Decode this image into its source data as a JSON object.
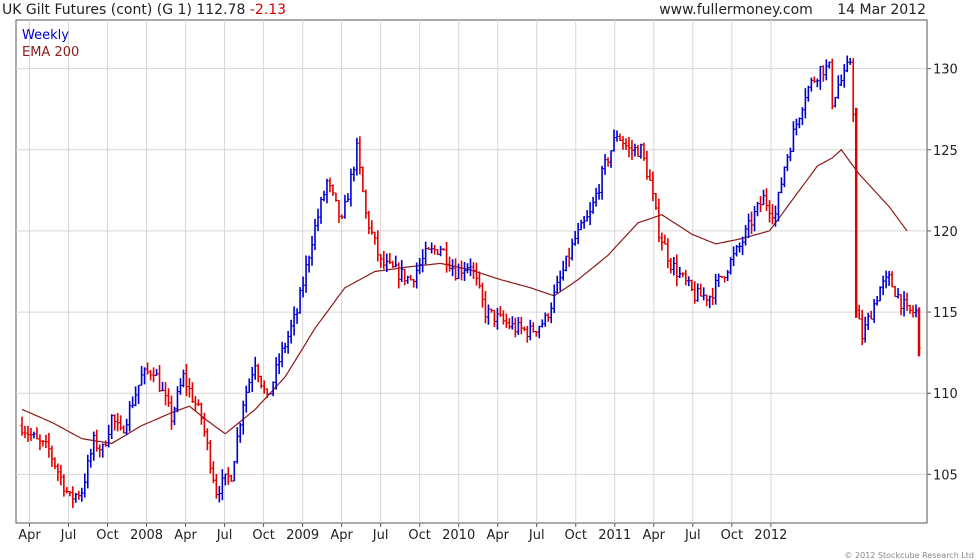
{
  "header": {
    "title": "UK Gilt Futures (cont) (G 1)",
    "last": "112.78",
    "change": "-2.13",
    "site": "www.fullermoney.com",
    "date": "14 Mar 2012"
  },
  "footer": "© 2012 Stockcube Research Ltd",
  "colors": {
    "up": "#0000cc",
    "down": "#e00000",
    "ema": "#8b1a1a",
    "grid": "#d7d7d7",
    "frame": "#555555"
  },
  "chart_data": {
    "type": "line",
    "title": "UK Gilt Futures (cont) (G 1)",
    "ylim": [
      102,
      133
    ],
    "yticks": [
      105,
      110,
      115,
      120,
      125,
      130
    ],
    "xticks": [
      "Apr",
      "Jul",
      "Oct",
      "2008",
      "Apr",
      "Jul",
      "Oct",
      "2009",
      "Apr",
      "Jul",
      "Oct",
      "2010",
      "Apr",
      "Jul",
      "Oct",
      "2011",
      "Apr",
      "Jul",
      "Oct",
      "2012"
    ],
    "legend": {
      "position": "top-left",
      "entries": [
        "Weekly",
        "EMA 200"
      ]
    },
    "grid": true,
    "x_start": "2007-03-30",
    "series": [
      {
        "name": "Weekly",
        "kind": "price",
        "anchors": [
          [
            0,
            108
          ],
          [
            5,
            107
          ],
          [
            9,
            106.5
          ],
          [
            16,
            103.5
          ],
          [
            20,
            104
          ],
          [
            24,
            107
          ],
          [
            27,
            106.5
          ],
          [
            30,
            108.5
          ],
          [
            33,
            107.5
          ],
          [
            40,
            111
          ],
          [
            44,
            111.5
          ],
          [
            50,
            108.5
          ],
          [
            54,
            111
          ],
          [
            60,
            108.5
          ],
          [
            65,
            104
          ],
          [
            70,
            105
          ],
          [
            74,
            109.5
          ],
          [
            78,
            112
          ],
          [
            82,
            109.5
          ],
          [
            86,
            112
          ],
          [
            92,
            115
          ],
          [
            97,
            119.5
          ],
          [
            102,
            123
          ],
          [
            107,
            120.5
          ],
          [
            112,
            125
          ],
          [
            115,
            121
          ],
          [
            120,
            118
          ],
          [
            125,
            117.5
          ],
          [
            130,
            117
          ],
          [
            135,
            118.5
          ],
          [
            140,
            119
          ],
          [
            145,
            117.5
          ],
          [
            150,
            118
          ],
          [
            155,
            115
          ],
          [
            160,
            114.5
          ],
          [
            165,
            114
          ],
          [
            170,
            113.8
          ],
          [
            175,
            114.5
          ],
          [
            180,
            117
          ],
          [
            185,
            119.5
          ],
          [
            190,
            121
          ],
          [
            195,
            124
          ],
          [
            199,
            126
          ],
          [
            203,
            125
          ],
          [
            207,
            125
          ],
          [
            210,
            123
          ],
          [
            213,
            120
          ],
          [
            217,
            118
          ],
          [
            221,
            117
          ],
          [
            225,
            116
          ],
          [
            230,
            116
          ],
          [
            235,
            117.5
          ],
          [
            240,
            119
          ],
          [
            245,
            121
          ],
          [
            248,
            122
          ],
          [
            252,
            121
          ],
          [
            255,
            124
          ],
          [
            258,
            126
          ],
          [
            262,
            128.5
          ],
          [
            267,
            130
          ],
          [
            270,
            130
          ],
          [
            271,
            128
          ],
          [
            273,
            129
          ],
          [
            275,
            129.5
          ],
          [
            277,
            130.5
          ],
          [
            278,
            127.5
          ],
          [
            279,
            115
          ],
          [
            281,
            113.5
          ],
          [
            284,
            115
          ],
          [
            287,
            116.5
          ],
          [
            290,
            117
          ],
          [
            293,
            116
          ],
          [
            296,
            115
          ],
          [
            299,
            115
          ],
          [
            300,
            112.78
          ]
        ]
      },
      {
        "name": "EMA 200",
        "kind": "line",
        "anchors": [
          [
            0,
            109
          ],
          [
            10,
            108.2
          ],
          [
            20,
            107.2
          ],
          [
            30,
            106.9
          ],
          [
            40,
            108
          ],
          [
            50,
            108.8
          ],
          [
            56,
            109.2
          ],
          [
            62,
            108.3
          ],
          [
            68,
            107.5
          ],
          [
            78,
            109
          ],
          [
            88,
            111
          ],
          [
            98,
            114
          ],
          [
            108,
            116.5
          ],
          [
            118,
            117.5
          ],
          [
            130,
            117.8
          ],
          [
            140,
            118
          ],
          [
            150,
            117.6
          ],
          [
            160,
            117
          ],
          [
            170,
            116.5
          ],
          [
            178,
            116
          ],
          [
            186,
            117
          ],
          [
            196,
            118.5
          ],
          [
            206,
            120.5
          ],
          [
            214,
            121
          ],
          [
            224,
            119.8
          ],
          [
            232,
            119.2
          ],
          [
            240,
            119.5
          ],
          [
            250,
            120
          ],
          [
            258,
            122
          ],
          [
            266,
            124
          ],
          [
            271,
            124.5
          ],
          [
            274,
            125
          ],
          [
            280,
            123.5
          ],
          [
            290,
            121.5
          ],
          [
            296,
            120
          ]
        ]
      }
    ]
  }
}
